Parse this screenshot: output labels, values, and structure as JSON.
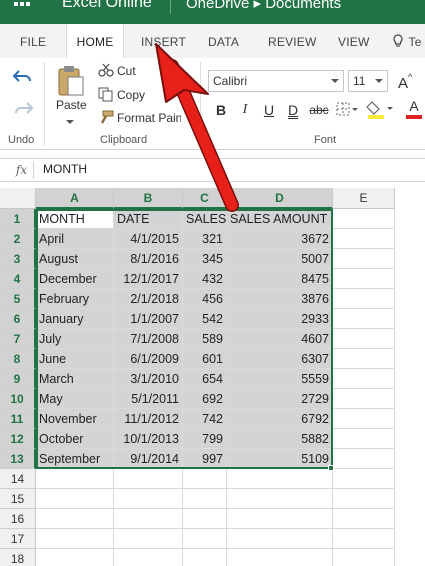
{
  "titlebar": {
    "app_name": "Excel Online",
    "breadcrumb": "OneDrive ▸ Documents"
  },
  "tabs": [
    {
      "label": "FILE"
    },
    {
      "label": "HOME"
    },
    {
      "label": "INSERT"
    },
    {
      "label": "DATA"
    },
    {
      "label": "REVIEW"
    },
    {
      "label": "VIEW"
    }
  ],
  "tell_me_icon": "lightbulb-icon",
  "tell_me_fragment": "Te",
  "ribbon": {
    "undo": {
      "group_label": "Undo"
    },
    "clipboard": {
      "paste_label": "Paste",
      "cut_label": "Cut",
      "copy_label": "Copy",
      "format_painter_label": "Format Painter",
      "group_label": "Clipboard"
    },
    "font": {
      "font_name": "Calibri",
      "font_size": "11",
      "bold": "B",
      "italic": "I",
      "underline": "U",
      "double_underline": "D",
      "strikethrough": "abc",
      "grow_font": "A",
      "font_color_letter": "A",
      "group_label": "Font",
      "accent_fill": "#ffeb3b",
      "accent_font": "#e02020"
    }
  },
  "formula_bar": {
    "fx": "fx",
    "value": "MONTH"
  },
  "grid": {
    "columns": [
      "A",
      "B",
      "C",
      "D",
      "E"
    ],
    "rows": [
      "1",
      "2",
      "3",
      "4",
      "5",
      "6",
      "7",
      "8",
      "9",
      "10",
      "11",
      "12",
      "13",
      "14",
      "15",
      "16",
      "17",
      "18"
    ],
    "header_row": [
      "MONTH",
      "DATE",
      "SALES",
      "SALES AMOUNT"
    ],
    "data": [
      [
        "April",
        "4/1/2015",
        "321",
        "3672"
      ],
      [
        "August",
        "8/1/2016",
        "345",
        "5007"
      ],
      [
        "December",
        "12/1/2017",
        "432",
        "8475"
      ],
      [
        "February",
        "2/1/2018",
        "456",
        "3876"
      ],
      [
        "January",
        "1/1/2007",
        "542",
        "2933"
      ],
      [
        "July",
        "7/1/2008",
        "589",
        "4607"
      ],
      [
        "June",
        "6/1/2009",
        "601",
        "6307"
      ],
      [
        "March",
        "3/1/2010",
        "654",
        "5559"
      ],
      [
        "May",
        "5/1/2011",
        "692",
        "2729"
      ],
      [
        "November",
        "11/1/2012",
        "742",
        "6792"
      ],
      [
        "October",
        "10/1/2013",
        "799",
        "5882"
      ],
      [
        "September",
        "9/1/2014",
        "997",
        "5109"
      ]
    ],
    "selection": "A1:D13",
    "accent_color": "#217346"
  },
  "annotation": {
    "arrow_color": "#e8201a"
  }
}
